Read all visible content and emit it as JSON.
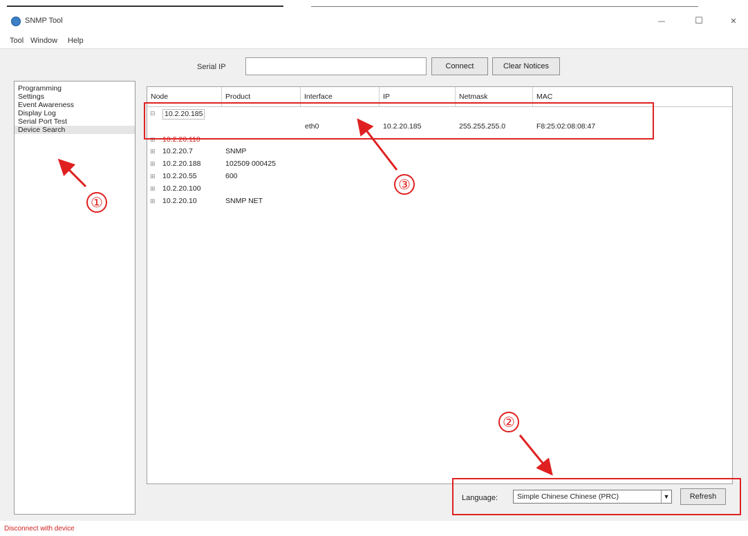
{
  "window": {
    "title": "SNMP Tool",
    "minimize": "—",
    "maximize": "☐",
    "close": "✕"
  },
  "menu": [
    "Tool",
    "Window",
    "Help"
  ],
  "toolbar": {
    "serial_label": "Serial IP",
    "serial_value": "",
    "connect_label": "Connect",
    "clear_label": "Clear Notices"
  },
  "sidebar": {
    "items": [
      {
        "label": "Programming"
      },
      {
        "label": "Settings"
      },
      {
        "label": "Event Awareness"
      },
      {
        "label": "Display Log"
      },
      {
        "label": "Serial Port Test"
      },
      {
        "label": "Device Search",
        "selected": true
      }
    ]
  },
  "grid": {
    "columns": [
      "Node",
      "Product",
      "Interface",
      "IP",
      "Netmask",
      "MAC"
    ],
    "rows": [
      {
        "node": "10.2.20.185",
        "product": "",
        "style": "first"
      },
      {
        "node": "10.2.20.110",
        "product": "",
        "style": "red"
      },
      {
        "node": "10.2.20.7",
        "product": "SNMP",
        "style": "normal"
      },
      {
        "node": "10.2.20.188",
        "product": "102509 000425",
        "style": "normal"
      },
      {
        "node": "10.2.20.55",
        "product": "600",
        "style": "normal"
      },
      {
        "node": "10.2.20.100",
        "product": "",
        "style": "normal"
      },
      {
        "node": "10.2.20.10",
        "product": "SNMP NET",
        "style": "normal"
      }
    ],
    "detail": {
      "interface": "eth0",
      "ip": "10.2.20.185",
      "netmask": "255.255.255.0",
      "mac": "F8:25:02:08:08:47"
    }
  },
  "bottom": {
    "language_label": "Language:",
    "language_value": "Simple Chinese Chinese (PRC)",
    "refresh_label": "Refresh"
  },
  "status": {
    "text": "Disconnect with device"
  },
  "annotations": {
    "one": "①",
    "two": "②",
    "three": "③"
  },
  "colors": {
    "annotation": "#e02020",
    "status_text": "#d02020"
  }
}
